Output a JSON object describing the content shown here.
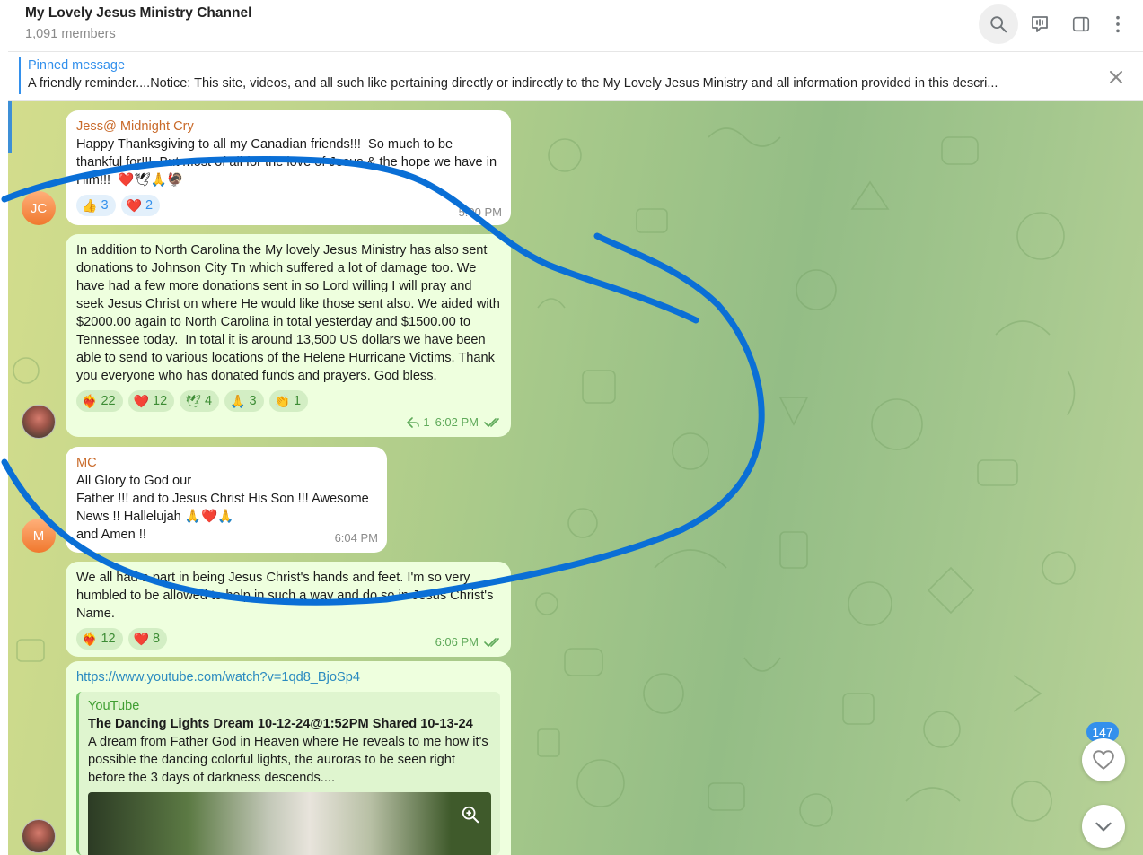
{
  "header": {
    "title": "My Lovely Jesus Ministry Channel",
    "members": "1,091 members",
    "icons": [
      "search-icon",
      "live-stream-icon",
      "sidebar-toggle-icon",
      "more-vert-icon"
    ]
  },
  "pinned": {
    "label": "Pinned message",
    "text": "A friendly reminder....Notice: This site, videos, and all such like pertaining directly or indirectly to the My Lovely Jesus Ministry and all information provided in this descri..."
  },
  "messages": [
    {
      "avatar_initials": "JC",
      "author": "Jess@ Midnight Cry",
      "text": "Happy Thanksgiving to all my Canadian friends!!!  So much to be thankful for!!!  But most of all for the love of Jesus & the hope we have in Him!!!  ❤️🕊🙏🦃",
      "time": "5:00 PM",
      "reactions": [
        {
          "icon": "👍",
          "count": "3"
        },
        {
          "icon": "❤️",
          "count": "2"
        }
      ]
    },
    {
      "text": "In addition to North Carolina the My lovely Jesus Ministry has also sent donations to Johnson City Tn which suffered a lot of damage too. We have had a few more donations sent in so Lord willing I will pray and seek Jesus Christ on where He would like those sent also. We aided with $2000.00 again to North Carolina in total yesterday and $1500.00 to Tennessee today.  In total it is around 13,500 US dollars we have been able to send to various locations of the Helene Hurricane Victims. Thank you everyone who has donated funds and prayers. God bless.",
      "replies": "1",
      "time": "6:02 PM",
      "reactions": [
        {
          "icon": "❤️‍🔥",
          "count": "22"
        },
        {
          "icon": "❤️",
          "count": "12"
        },
        {
          "icon": "🕊",
          "count": "4"
        },
        {
          "icon": "🙏",
          "count": "3"
        },
        {
          "icon": "👏",
          "count": "1"
        }
      ]
    },
    {
      "avatar_initials": "M",
      "author": "MC",
      "text": "All Glory to God our\nFather !!! and to Jesus Christ His Son !!! Awesome News !! Hallelujah 🙏❤️🙏\nand Amen !!",
      "time": "6:04 PM"
    },
    {
      "text": "We all had a part in being Jesus Christ's hands and feet. I'm so very humbled to be allowed to help in such a way and do so in Jesus Christ's Name.",
      "time": "6:06 PM",
      "reactions": [
        {
          "icon": "❤️‍🔥",
          "count": "12"
        },
        {
          "icon": "❤️",
          "count": "8"
        }
      ]
    },
    {
      "link": "https://www.youtube.com/watch?v=1qd8_BjoSp4",
      "preview": {
        "site": "YouTube",
        "title": "The Dancing Lights Dream 10-12-24@1:52PM Shared 10-13-24",
        "description": "A dream from Father God in Heaven where He reveals to me how it's possible the dancing colorful lights, the auroras to be seen right before the 3 days of darkness descends...."
      }
    }
  ],
  "floating": {
    "like_count": "147"
  },
  "colors": {
    "accent": "#3390ec",
    "own_bubble": "#eeffde",
    "author_name": "#c96a2a",
    "annotation_stroke": "#0a6fd6"
  }
}
